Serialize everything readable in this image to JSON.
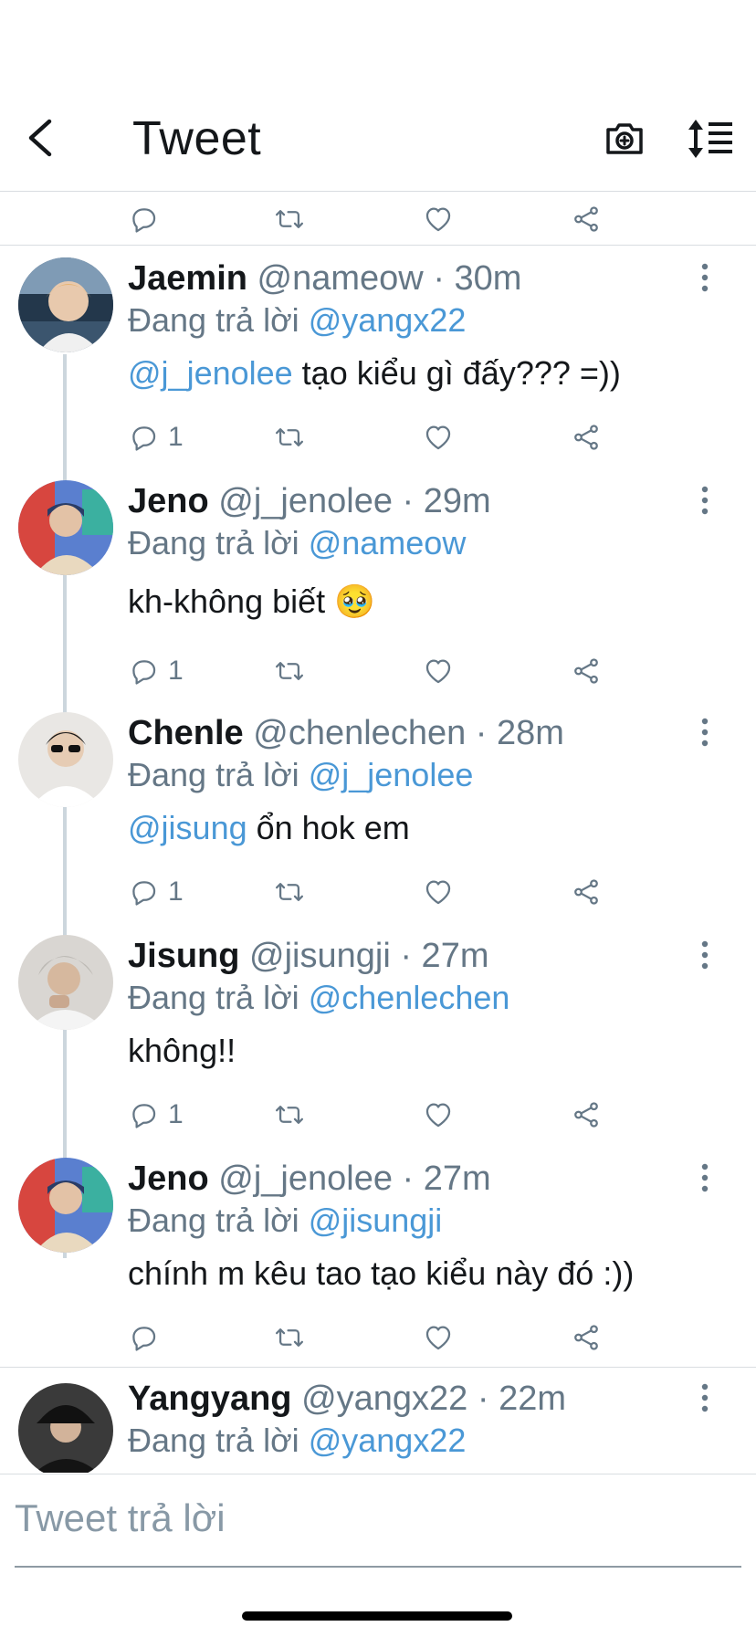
{
  "header": {
    "title": "Tweet"
  },
  "icons": {
    "back": "chevron-left-icon",
    "camera": "camera-icon",
    "sort": "sort-icon",
    "reply": "reply-bubble-icon",
    "retweet": "retweet-icon",
    "like": "heart-icon",
    "share": "share-icon",
    "more": "more-vertical-icon"
  },
  "colors": {
    "link": "#4a98d6",
    "muted": "#657786",
    "divider": "#d9dde1"
  },
  "replying_label": "Đang trả lời",
  "tweets": [
    {
      "name": "Jaemin",
      "handle": "@nameow",
      "time": "· 30m",
      "reply_to": "@yangx22",
      "mention": "@j_jenolee",
      "text": " tạo kiểu gì đấy??? =))",
      "reply_count": "1"
    },
    {
      "name": "Jeno",
      "handle": "@j_jenolee",
      "time": "· 29m",
      "reply_to": "@nameow",
      "mention": "",
      "text": "kh-không biết 🥹",
      "reply_count": "1"
    },
    {
      "name": "Chenle",
      "handle": "@chenlechen",
      "time": "· 28m",
      "reply_to": "@j_jenolee",
      "mention": "@jisung",
      "text": " ổn hok em",
      "reply_count": "1"
    },
    {
      "name": "Jisung",
      "handle": "@jisungji",
      "time": "· 27m",
      "reply_to": "@chenlechen",
      "mention": "",
      "text": "không!!",
      "reply_count": "1"
    },
    {
      "name": "Jeno",
      "handle": "@j_jenolee",
      "time": "· 27m",
      "reply_to": "@jisungji",
      "mention": "",
      "text": "chính m kêu tao tạo kiểu này đó :))",
      "reply_count": ""
    },
    {
      "name": "Yangyang",
      "handle": "@yangx22",
      "time": "· 22m",
      "reply_to": "@yangx22"
    }
  ],
  "composer": {
    "placeholder": "Tweet trả lời"
  }
}
